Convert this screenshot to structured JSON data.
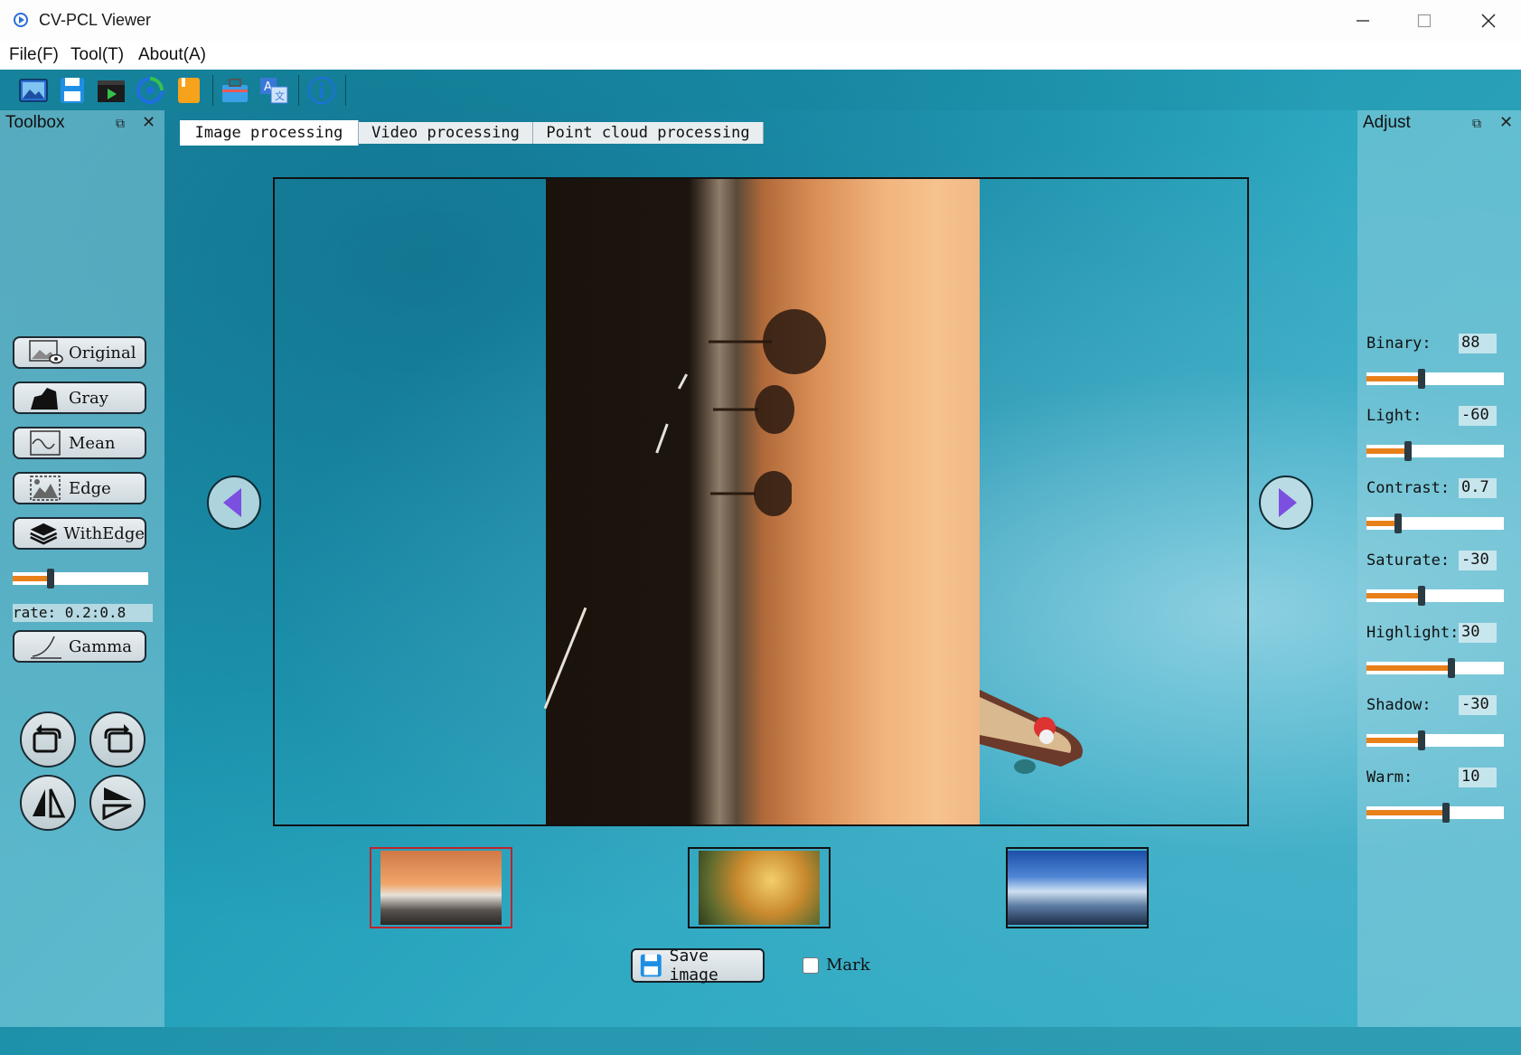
{
  "window": {
    "title": "CV-PCL Viewer",
    "minimize_icon": "minimize-icon",
    "maximize_icon": "maximize-icon",
    "close_icon": "close-icon"
  },
  "menu": {
    "file": "File(F)",
    "tool": "Tool(T)",
    "about": "About(A)"
  },
  "toolbar": {
    "icons": [
      "open-image-icon",
      "save-icon",
      "video-icon",
      "refresh-icon",
      "notebook-icon",
      "toolbox-icon",
      "translate-icon",
      "info-icon"
    ]
  },
  "toolbox": {
    "title": "Toolbox",
    "buttons": {
      "original": "Original",
      "gray": "Gray",
      "mean": "Mean",
      "edge": "Edge",
      "withedge": "WithEdge",
      "gamma": "Gamma"
    },
    "rate_label": "rate: 0.2:0.8",
    "rate_slider_fraction": 0.28,
    "transform_icons": [
      "rotate-left-icon",
      "rotate-right-icon",
      "flip-horizontal-icon",
      "flip-vertical-icon"
    ]
  },
  "tabs": [
    "Image processing",
    "Video processing",
    "Point cloud processing"
  ],
  "active_tab": "Image processing",
  "viewer": {
    "prev_icon": "prev-arrow-icon",
    "next_icon": "next-arrow-icon",
    "selected_thumbnail": 0
  },
  "bottom": {
    "save_label": "Save image",
    "mark_label": "Mark",
    "mark_checked": false
  },
  "adjust": {
    "title": "Adjust",
    "items": [
      {
        "label": "Binary:",
        "value": "88",
        "fraction": 0.4
      },
      {
        "label": "Light:",
        "value": "-60",
        "fraction": 0.3
      },
      {
        "label": "Contrast:",
        "value": "0.7",
        "fraction": 0.23
      },
      {
        "label": "Saturate:",
        "value": "-30",
        "fraction": 0.4
      },
      {
        "label": "Highlight:",
        "value": "30",
        "fraction": 0.62
      },
      {
        "label": "Shadow:",
        "value": "-30",
        "fraction": 0.4
      },
      {
        "label": "Warm:",
        "value": "10",
        "fraction": 0.58
      }
    ]
  },
  "colors": {
    "accent_orange": "#e8801a",
    "nav_purple": "#7b4fe0",
    "selected_border": "#c0232c"
  }
}
